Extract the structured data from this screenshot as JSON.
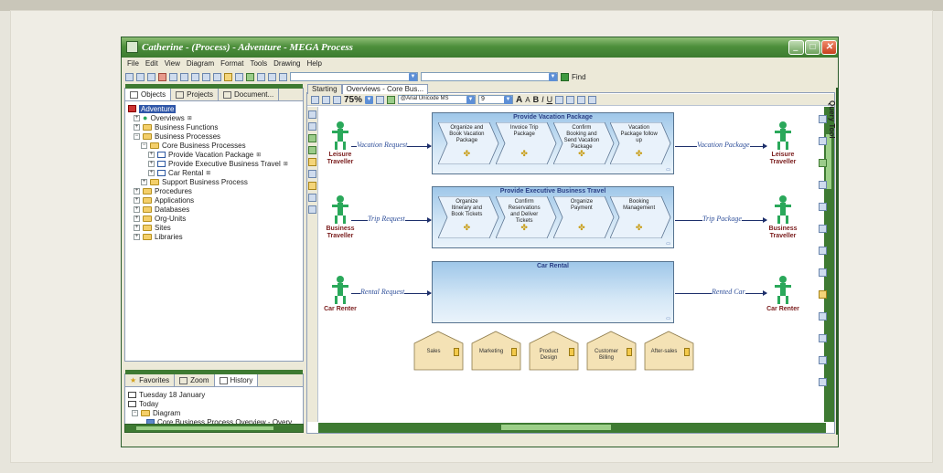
{
  "window": {
    "title": "Catherine - (Process) - Adventure - MEGA Process"
  },
  "menu": [
    "File",
    "Edit",
    "View",
    "Diagram",
    "Format",
    "Tools",
    "Drawing",
    "Help"
  ],
  "toolbar": {
    "find_label": "Find"
  },
  "left_panel": {
    "tabs": [
      "Objects",
      "Projects",
      "Document..."
    ],
    "tree": [
      {
        "label": "Adventure",
        "level": 0,
        "selected": true
      },
      {
        "label": "Overviews",
        "level": 1
      },
      {
        "label": "Business Functions",
        "level": 1
      },
      {
        "label": "Business Processes",
        "level": 1
      },
      {
        "label": "Core Business Processes",
        "level": 2
      },
      {
        "label": "Provide Vacation Package",
        "level": 3
      },
      {
        "label": "Provide Executive Business Travel",
        "level": 3
      },
      {
        "label": "Car Rental",
        "level": 3
      },
      {
        "label": "Support Business Process",
        "level": 2
      },
      {
        "label": "Procedures",
        "level": 1
      },
      {
        "label": "Applications",
        "level": 1
      },
      {
        "label": "Databases",
        "level": 1
      },
      {
        "label": "Org-Units",
        "level": 1
      },
      {
        "label": "Sites",
        "level": 1
      },
      {
        "label": "Libraries",
        "level": 1
      }
    ]
  },
  "bottom_panel": {
    "tabs": [
      "Favorites",
      "Zoom",
      "History"
    ],
    "history": [
      {
        "label": "Tuesday 18 January"
      },
      {
        "label": "Today"
      },
      {
        "label": "Diagram"
      },
      {
        "label": "Core Business Process Overview - Overv"
      }
    ]
  },
  "doc": {
    "tabs": [
      "Starting",
      "Overviews - Core Bus..."
    ],
    "zoom": "75%",
    "font": "@Arial Unicode MS",
    "font_size": "9",
    "querytool_label": "Query Tool"
  },
  "diagram": {
    "processes": [
      {
        "title": "Provide Vacation Package",
        "steps": [
          "Organize and Book Vacation Package",
          "Invoice Trip Package",
          "Confirm Booking and Send Vacation Package",
          "Vacation Package follow up"
        ]
      },
      {
        "title": "Provide Executive Business Travel",
        "steps": [
          "Organize Itinerary and Book Tickets",
          "Confirm Reservations and Deliver Tickets",
          "Organize Payment",
          "Booking Management"
        ]
      },
      {
        "title": "Car Rental",
        "steps": []
      }
    ],
    "actors": {
      "r1_left": "Leisure Traveller",
      "r1_right": "Leisure Traveller",
      "r2_left": "Business Traveller",
      "r2_right": "Business Traveller",
      "r3_left": "Car Renter",
      "r3_right": "Car Renter"
    },
    "flows": {
      "r1_in": "Vacation Request",
      "r1_out": "Vacation Package",
      "r2_in": "Trip Request",
      "r2_out": "Trip Package",
      "r3_in": "Rental Request",
      "r3_out": "Rented Car"
    },
    "org_units": [
      "Sales",
      "Marketing",
      "Product Design",
      "Customer Billing",
      "After-sales"
    ]
  }
}
